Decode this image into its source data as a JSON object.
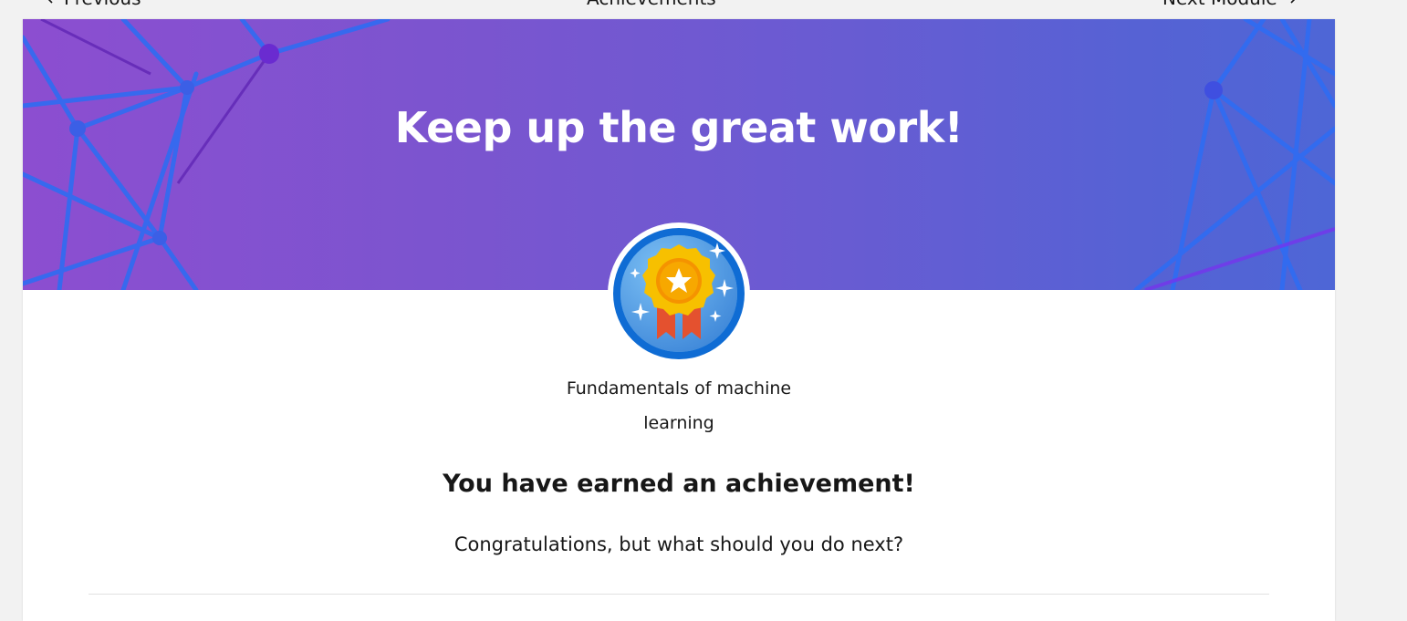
{
  "nav": {
    "previous_label": "Previous",
    "center_label": "Achievements",
    "next_label": "Next Module"
  },
  "hero": {
    "title": "Keep up the great work!"
  },
  "badge": {
    "icon": "medal-star-icon",
    "module_name": "Fundamentals of machine learning"
  },
  "content": {
    "heading": "You have earned an achievement!",
    "subtext": "Congratulations, but what should you do next?"
  },
  "colors": {
    "hero_start": "#8c4ed0",
    "hero_end": "#4e66d6",
    "badge_ring": "#0f6cd4",
    "medal_gold": "#f7b500",
    "ribbon": "#e4512f"
  }
}
